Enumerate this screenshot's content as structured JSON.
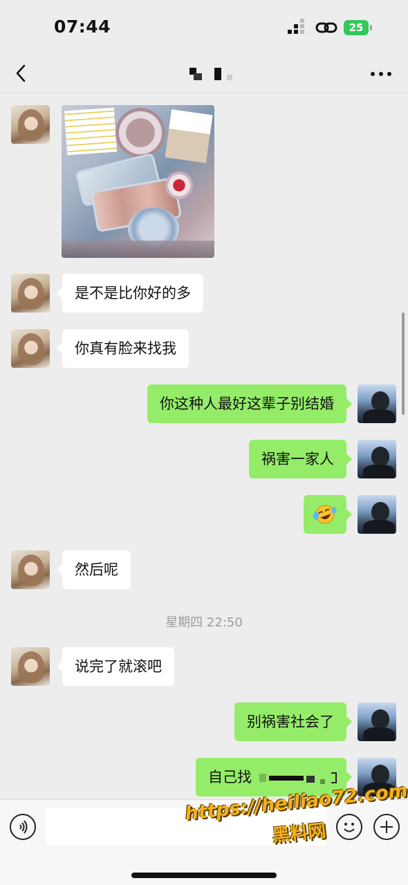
{
  "status_bar": {
    "time": "07:44",
    "battery": "25"
  },
  "nav": {
    "back_icon": "chevron-left-icon",
    "more_icon": "more-dots-icon"
  },
  "messages": [
    {
      "side": "in",
      "type": "image"
    },
    {
      "side": "in",
      "type": "text",
      "text": "是不是比你好的多"
    },
    {
      "side": "in",
      "type": "text",
      "text": "你真有脸来找我"
    },
    {
      "side": "out",
      "type": "text",
      "text": "你这种人最好这辈子别结婚"
    },
    {
      "side": "out",
      "type": "text",
      "text": "祸害一家人"
    },
    {
      "side": "out",
      "type": "emoji",
      "icon": "rolling-laughing-emoji"
    },
    {
      "side": "in",
      "type": "text",
      "text": "然后呢"
    },
    {
      "side": "timestamp",
      "text": "星期四 22:50"
    },
    {
      "side": "in",
      "type": "text",
      "text": "说完了就滚吧"
    },
    {
      "side": "out",
      "type": "text",
      "text": "别祸害社会了"
    },
    {
      "side": "out",
      "type": "text",
      "text": "自己找"
    }
  ],
  "input_bar": {
    "voice_icon": "voice-icon",
    "emoji_icon": "emoji-icon",
    "add_icon": "add-icon",
    "placeholder": ""
  },
  "watermark": {
    "url": "https://heiliao72.com",
    "name": "黑料网"
  },
  "colors": {
    "background": "#ededed",
    "incoming_bubble": "#ffffff",
    "outgoing_bubble": "#95ec69",
    "watermark": "#f3b21b",
    "battery": "#34c759"
  }
}
